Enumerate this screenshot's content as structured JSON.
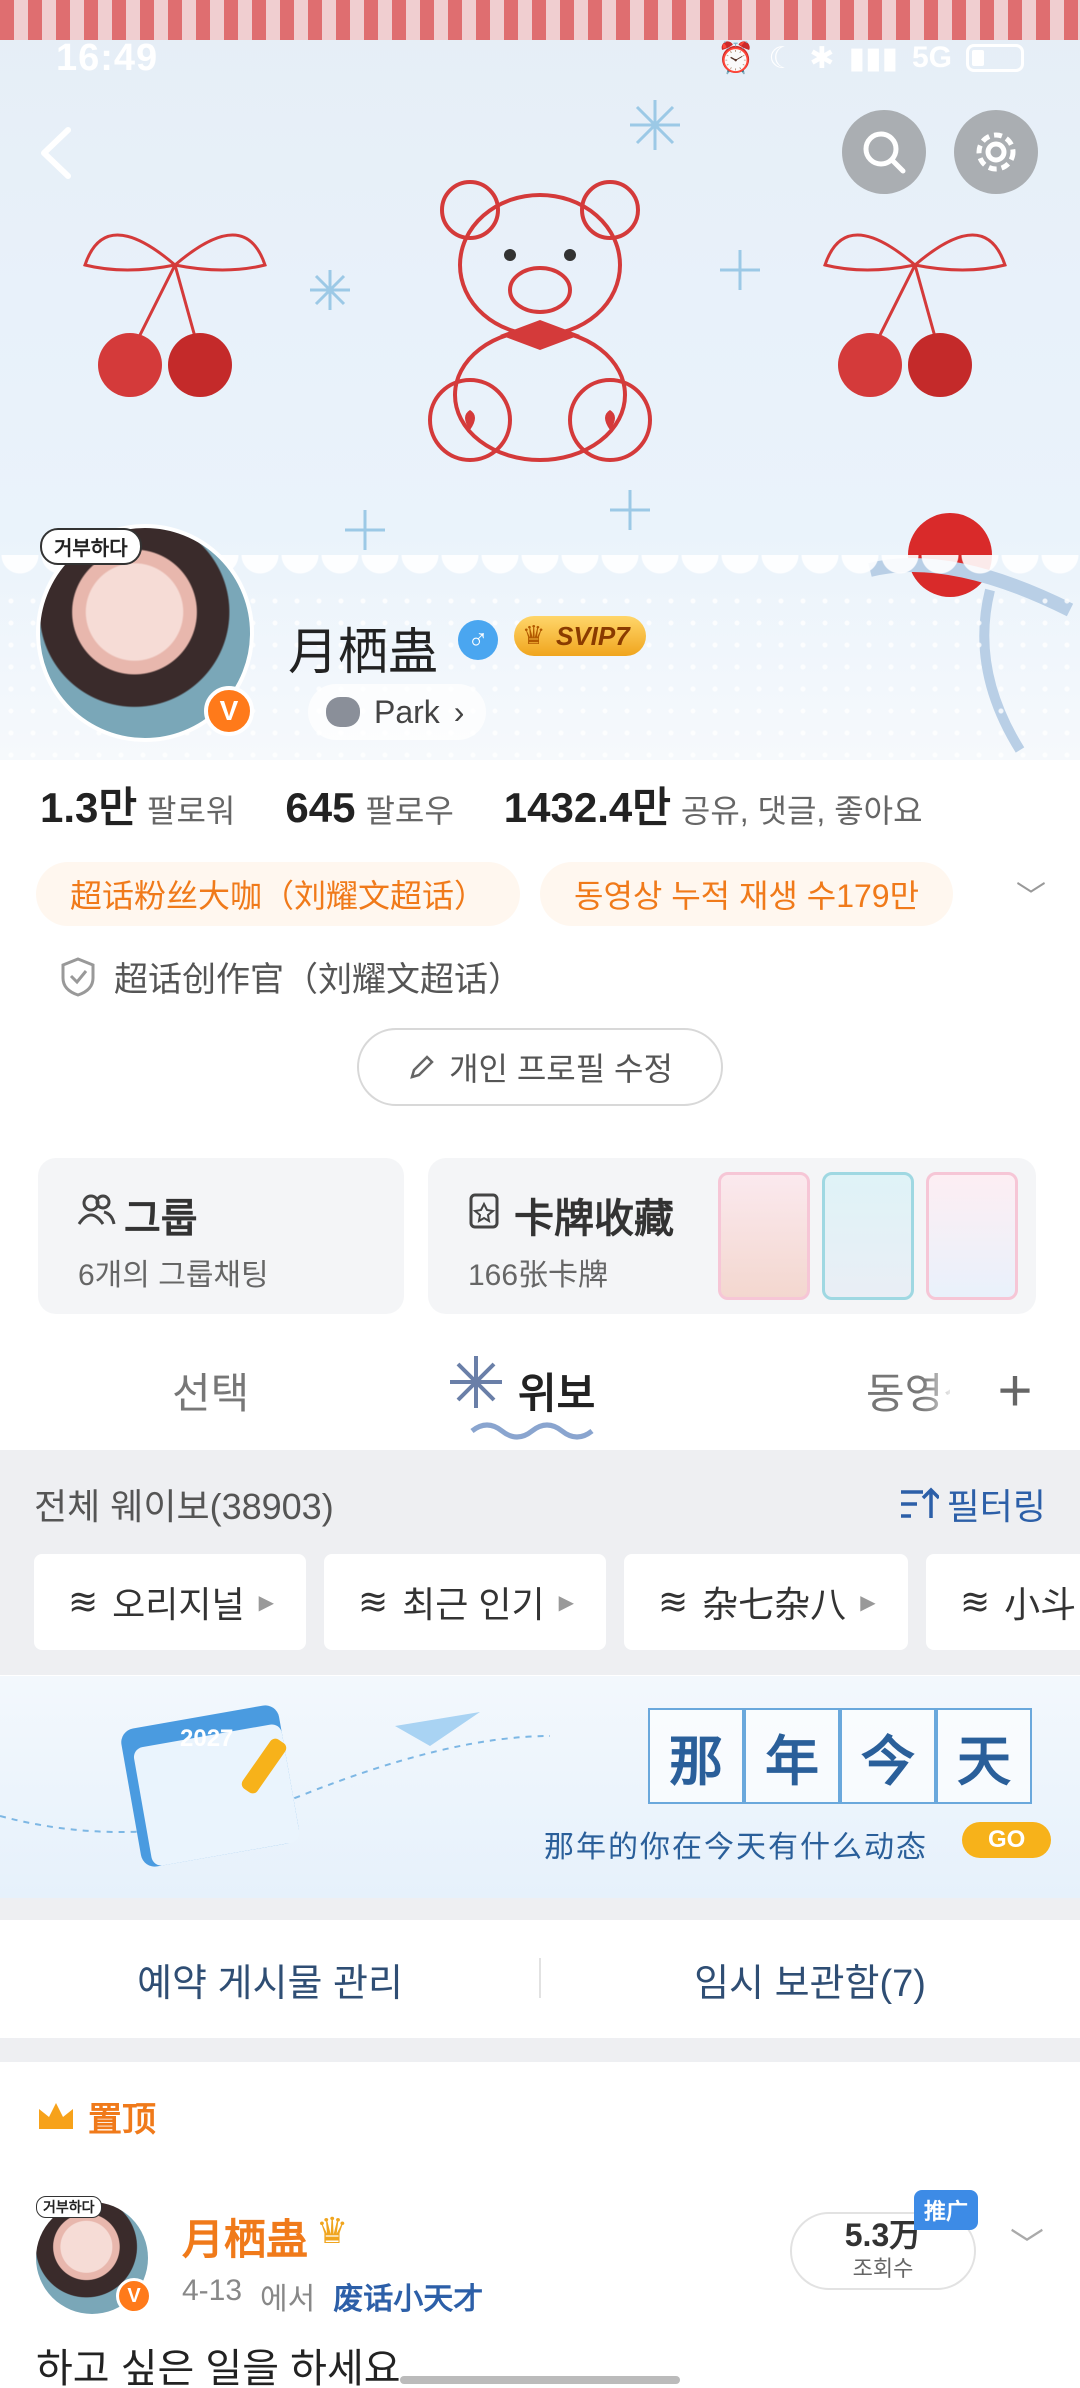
{
  "status_bar": {
    "time": "16:49",
    "network": "5G"
  },
  "header": {
    "back_icon": "back-arrow-icon",
    "search_icon": "search-icon",
    "settings_icon": "gear-icon"
  },
  "profile": {
    "avatar_tag": "거부하다",
    "name": "月栖蛊",
    "gender_symbol": "♂",
    "vip_label": "SVIP7",
    "verified_letter": "V",
    "park_label": "Park",
    "park_chevron": "›"
  },
  "stats": [
    {
      "number": "1.3만",
      "label": "팔로워"
    },
    {
      "number": "645",
      "label": "팔로우"
    },
    {
      "number": "1432.4만",
      "label": "공유, 댓글, 좋아요"
    }
  ],
  "tags": {
    "first": "超话粉丝大咖（刘耀文超话）",
    "second": "동영상 누적 재생 수179만",
    "chevron": "﹀"
  },
  "creator_badge": "超话创作官（刘耀文超话）",
  "edit_profile_label": "개인 프로필 수정",
  "cards": {
    "group": {
      "title": "그룹",
      "subtitle": "6개의 그룹채팅"
    },
    "cards_collection": {
      "title": "卡牌收藏",
      "subtitle": "166张卡牌"
    }
  },
  "tabs": {
    "items": [
      {
        "label": "선택"
      },
      {
        "label": "위보"
      },
      {
        "label": "동영상"
      }
    ],
    "active_index": 1,
    "add_label": "+"
  },
  "filter": {
    "all_weibo": "전체 웨이보(38903)",
    "filter_label": "필터링",
    "chips": [
      {
        "label": "오리지널"
      },
      {
        "label": "최근 인기"
      },
      {
        "label": "杂七杂八"
      },
      {
        "label": "小斗"
      }
    ]
  },
  "banner": {
    "chars": [
      "那",
      "年",
      "今",
      "天"
    ],
    "subtitle": "那年的你在今天有什么动态",
    "go_label": "GO",
    "calendar_year": "2027"
  },
  "actions": {
    "scheduled": "예약 게시물 관리",
    "drafts": "임시 보관함(7)"
  },
  "pinned_label": "置顶",
  "post": {
    "avatar_tag": "거부하다",
    "author": "月栖蛊",
    "date": "4-13",
    "from_word": "에서",
    "source": "废话小天才",
    "views_num": "5.3万",
    "views_label": "조회수",
    "promo_label": "推广",
    "text": "하고 싶은 일을 하세요"
  },
  "colors": {
    "accent_orange": "#f07a1a",
    "link_blue": "#2c5fa8",
    "gender_blue": "#4aa6f0",
    "vip_gold": "#f0a51e"
  }
}
